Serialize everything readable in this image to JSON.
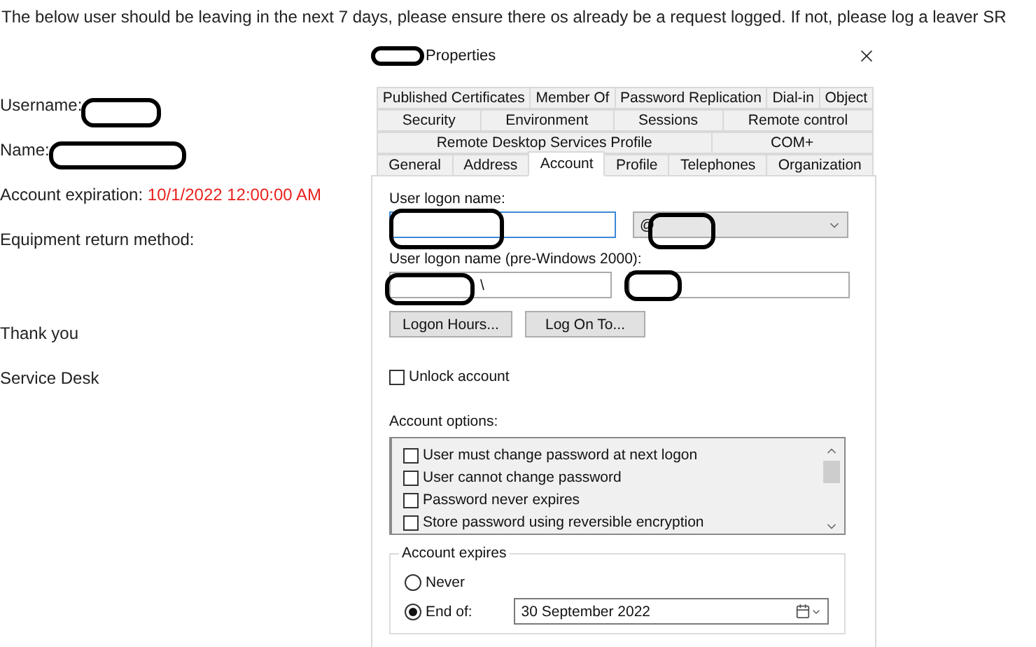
{
  "message": {
    "intro": "The below user should be leaving in the next 7 days, please ensure there os already be a request logged. If not, please log a leaver SR",
    "fields": [
      {
        "label": "Username:"
      },
      {
        "label": "Name:"
      },
      {
        "label": "Account expiration:",
        "value": "10/1/2022 12:00:00 AM"
      },
      {
        "label": "Equipment return method:"
      }
    ],
    "closing": [
      "Thank you",
      "Service Desk"
    ]
  },
  "dialog": {
    "title": "Properties",
    "tab_rows": [
      [
        {
          "label": "Published Certificates",
          "selected": false
        },
        {
          "label": "Member Of",
          "selected": false
        },
        {
          "label": "Password Replication",
          "selected": false
        },
        {
          "label": "Dial-in",
          "selected": false
        },
        {
          "label": "Object",
          "selected": false
        }
      ],
      [
        {
          "label": "Security",
          "selected": false
        },
        {
          "label": "Environment",
          "selected": false
        },
        {
          "label": "Sessions",
          "selected": false
        },
        {
          "label": "Remote control",
          "selected": false
        }
      ],
      [
        {
          "label": "Remote Desktop Services Profile",
          "selected": false
        },
        {
          "label": "COM+",
          "selected": false
        }
      ],
      [
        {
          "label": "General",
          "selected": false
        },
        {
          "label": "Address",
          "selected": false
        },
        {
          "label": "Account",
          "selected": true
        },
        {
          "label": "Profile",
          "selected": false
        },
        {
          "label": "Telephones",
          "selected": false
        },
        {
          "label": "Organization",
          "selected": false
        }
      ]
    ],
    "logon_label": "User logon name:",
    "domain_dropdown": {
      "value": "@"
    },
    "pre2000_label": "User logon name (pre-Windows 2000):",
    "pre2000_domain": {
      "value": "\\"
    },
    "buttons": [
      "Logon Hours...",
      "Log On To..."
    ],
    "unlock": {
      "label": "Unlock account",
      "checked": false
    },
    "options_label": "Account options:",
    "options": [
      {
        "label": "User must change password at next logon",
        "checked": false
      },
      {
        "label": "User cannot change password",
        "checked": false
      },
      {
        "label": "Password never expires",
        "checked": false
      },
      {
        "label": "Store password using reversible encryption",
        "checked": false
      }
    ],
    "expires": {
      "legend": "Account expires",
      "radios": [
        {
          "label": "Never",
          "selected": false
        },
        {
          "label": "End of:",
          "selected": true
        }
      ],
      "date": "30 September 2022"
    }
  }
}
